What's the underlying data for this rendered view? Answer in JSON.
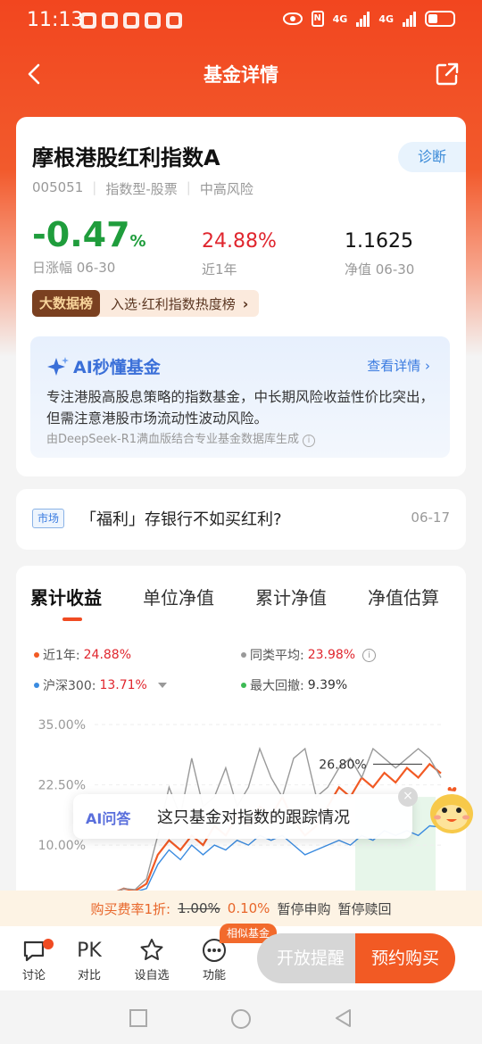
{
  "status_bar": {
    "time": "11:13",
    "net1": "4G",
    "net2": "4G"
  },
  "nav": {
    "title": "基金详情"
  },
  "fund": {
    "name": "摩根港股红利指数A",
    "code": "005051",
    "type": "指数型-股票",
    "risk": "中高风险",
    "diagnose_label": "诊断",
    "daily_change": "-0.47",
    "daily_change_unit": "%",
    "daily_change_label": "日涨幅 06-30",
    "year_return": "24.88%",
    "year_return_label": "近1年",
    "nav_value": "1.1625",
    "nav_label": "净值 06-30",
    "rank_tag": "大数据榜",
    "rank_text": "入选·红利指数热度榜",
    "rank_arrow": "›"
  },
  "ai_summary": {
    "title": "AI秒懂基金",
    "more": "查看详情 ›",
    "body": "专注港股高股息策略的指数基金，中长期风险收益性价比突出，但需注意港股市场流动性波动风险。",
    "source": "由DeepSeek-R1满血版结合专业基金数据库生成"
  },
  "news": {
    "tag": "市场",
    "title": "「福利」存银行不如买红利?",
    "date": "06-17"
  },
  "chart_tabs": [
    "累计收益",
    "单位净值",
    "累计净值",
    "净值估算"
  ],
  "legend": {
    "fund_label": "近1年:",
    "fund_value": "24.88%",
    "peer_label": "同类平均:",
    "peer_value": "23.98%",
    "index_label": "沪深300:",
    "index_value": "13.71%",
    "drawdown_label": "最大回撤:",
    "drawdown_value": "9.39%"
  },
  "colors": {
    "fund": "#f25a24",
    "peer": "#999999",
    "index": "#3a8be0",
    "drawdown": "#3cba54"
  },
  "chart_data": {
    "type": "line",
    "y_ticks": [
      "35.00%",
      "22.50%",
      "10.00%"
    ],
    "ylim": [
      -2,
      35
    ],
    "peak_label": "26.80%",
    "series": [
      {
        "name": "近1年",
        "values": [
          0,
          1,
          0.5,
          2,
          8,
          11,
          9,
          12,
          10,
          14,
          12,
          16,
          14,
          18,
          16,
          20,
          15,
          12,
          14,
          18,
          22,
          20,
          24,
          22,
          25,
          23,
          26,
          24,
          26.8,
          24.9
        ]
      },
      {
        "name": "同类平均",
        "values": [
          0,
          1,
          0.8,
          3,
          12,
          22,
          16,
          28,
          18,
          20,
          26,
          18,
          22,
          30,
          24,
          20,
          28,
          30,
          20,
          22,
          26,
          28,
          24,
          30,
          28,
          26,
          28,
          30,
          28,
          24
        ]
      },
      {
        "name": "沪深300",
        "values": [
          0,
          0.5,
          0.3,
          1,
          6,
          9,
          7,
          10,
          8,
          10,
          9,
          11,
          10,
          12,
          11,
          12,
          10,
          8,
          9,
          10,
          11,
          10,
          12,
          11,
          13,
          12,
          13,
          12,
          14,
          13.7
        ]
      }
    ]
  },
  "ai_prompt": {
    "label": "AI问答",
    "question": "这只基金对指数的跟踪情况"
  },
  "fee": {
    "label": "购买费率1折:",
    "old": "1.00%",
    "new": "0.10%",
    "status1": "暂停申购",
    "status2": "暂停赎回"
  },
  "bottom": {
    "discuss": "讨论",
    "compare_icon": "PK",
    "compare": "对比",
    "watchlist": "设自选",
    "functions": "功能",
    "similar_tag": "相似基金",
    "remind": "开放提醒",
    "buy": "预约购买"
  }
}
